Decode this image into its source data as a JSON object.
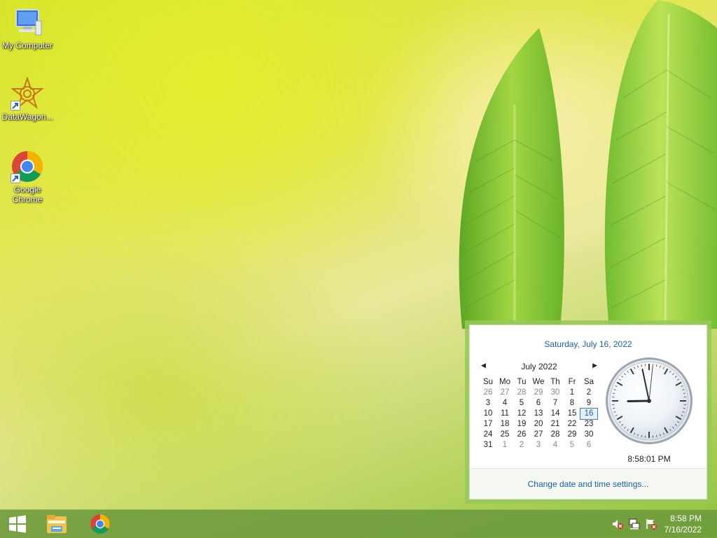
{
  "desktop": {
    "icons": [
      {
        "label": "My Computer"
      },
      {
        "label": "DataWagon..."
      },
      {
        "label": "Google Chrome"
      }
    ]
  },
  "flyout": {
    "long_date": "Saturday, July 16, 2022",
    "month_label": "July 2022",
    "weekdays": [
      "Su",
      "Mo",
      "Tu",
      "We",
      "Th",
      "Fr",
      "Sa"
    ],
    "days": [
      [
        "26",
        "27",
        "28",
        "29",
        "30",
        "1",
        "2"
      ],
      [
        "3",
        "4",
        "5",
        "6",
        "7",
        "8",
        "9"
      ],
      [
        "10",
        "11",
        "12",
        "13",
        "14",
        "15",
        "16"
      ],
      [
        "17",
        "18",
        "19",
        "20",
        "21",
        "22",
        "23"
      ],
      [
        "24",
        "25",
        "26",
        "27",
        "28",
        "29",
        "30"
      ],
      [
        "31",
        "1",
        "2",
        "3",
        "4",
        "5",
        "6"
      ]
    ],
    "today": "16",
    "analog_time": "8:58:01 PM",
    "settings_link": "Change date and time settings..."
  },
  "taskbar": {
    "time": "8:58 PM",
    "date": "7/16/2022"
  },
  "colors": {
    "accent_link": "#1b5fa8",
    "taskbar": "#6c9a3c"
  }
}
